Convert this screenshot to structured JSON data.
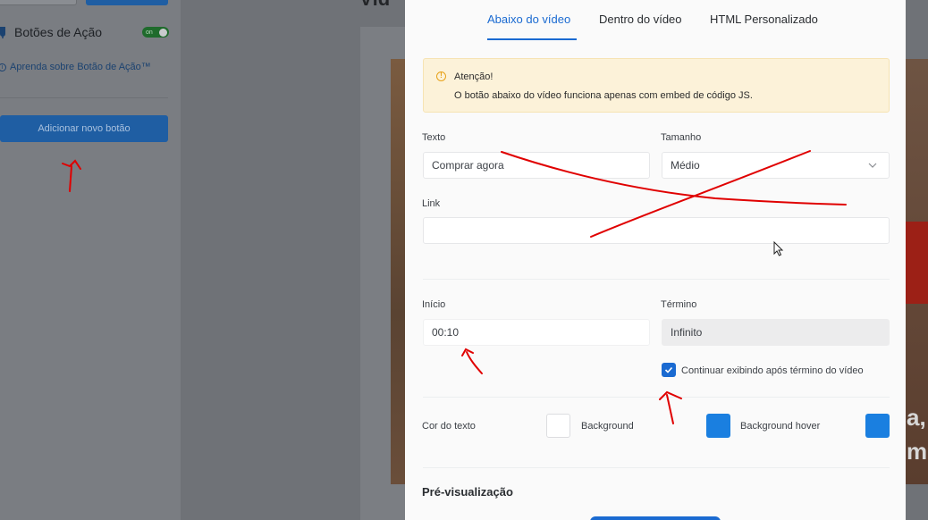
{
  "sidebar": {
    "section_title": "Botões de Ação",
    "toggle_text": "on",
    "learn_link": "Aprenda sobre Botão de Ação™",
    "add_button": "Adicionar novo botão"
  },
  "background": {
    "title_fragment": "Víd",
    "overlay_text_line1": "a,",
    "overlay_text_line2": "m"
  },
  "modal": {
    "tabs": [
      {
        "label": "Abaixo do vídeo",
        "active": true
      },
      {
        "label": "Dentro do vídeo",
        "active": false
      },
      {
        "label": "HTML Personalizado",
        "active": false
      }
    ],
    "alert": {
      "title": "Atenção!",
      "text": "O botão abaixo do vídeo funciona apenas com embed de código JS."
    },
    "texto": {
      "label": "Texto",
      "value": "Comprar agora"
    },
    "tamanho": {
      "label": "Tamanho",
      "value": "Médio"
    },
    "link": {
      "label": "Link",
      "value": ""
    },
    "inicio": {
      "label": "Início",
      "value": "00:10"
    },
    "termino": {
      "label": "Término",
      "value": "Infinito"
    },
    "continuar": {
      "label": "Continuar exibindo após término do vídeo",
      "checked": true
    },
    "colors": {
      "text_color_label": "Cor do texto",
      "text_color": "#ffffff",
      "background_label": "Background",
      "background_color": "#1a7fe0",
      "background_hover_label": "Background hover",
      "background_hover_color": "#1a7fe0"
    },
    "preview_title": "Pré-visualização"
  },
  "theme": {
    "accent": "#1a6ad1",
    "annotation_color": "#ff0000"
  }
}
